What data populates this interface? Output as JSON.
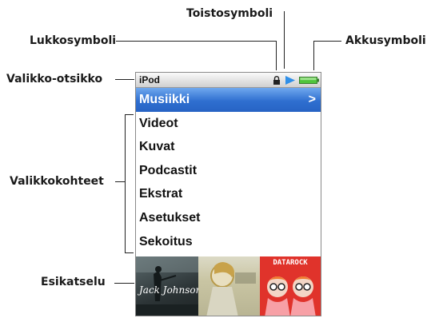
{
  "callouts": {
    "toisto": "Toistosymboli",
    "lukko": "Lukkosymboli",
    "akku": "Akkusymboli",
    "otsikko": "Valikko-otsikko",
    "kohteet": "Valikkokohteet",
    "esikatselu": "Esikatselu"
  },
  "screen": {
    "title": "iPod",
    "menu": [
      {
        "label": "Musiikki",
        "selected": true
      },
      {
        "label": "Videot"
      },
      {
        "label": "Kuvat"
      },
      {
        "label": "Podcastit"
      },
      {
        "label": "Ekstrat"
      },
      {
        "label": "Asetukset"
      },
      {
        "label": "Sekoitus"
      }
    ],
    "chevron": ">",
    "albums": [
      {
        "art_text": "Jack Johnson"
      },
      {
        "art_text": ""
      },
      {
        "art_text": "DATAROCK"
      }
    ]
  },
  "colors": {
    "selection": "#2f6fd0",
    "play": "#2f8fe8",
    "battery": "#4fc43c"
  }
}
